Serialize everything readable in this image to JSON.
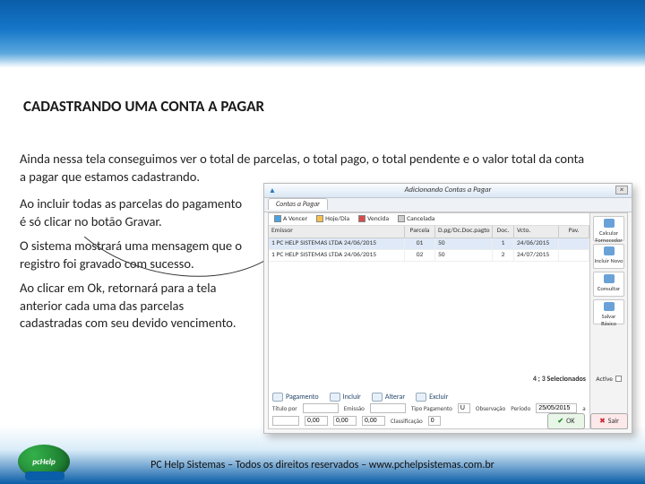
{
  "slide": {
    "title": "CADASTRANDO UMA CONTA A PAGAR",
    "intro": "Ainda nessa tela conseguimos ver o total de parcelas, o total pago, o total pendente e o valor total da conta a pagar que estamos cadastrando.",
    "para1": "Ao incluir todas as parcelas do pagamento é só clicar no botão Gravar.",
    "para2": "O sistema mostrará uma mensagem que o registro foi gravado com sucesso.",
    "para3": "Ao clicar em Ok, retornará para a tela anterior cada uma das parcelas cadastradas com seu devido vencimento.",
    "footer": "PC Help Sistemas – Todos os direitos reservados – www.pchelpsistemas.com.br",
    "logo_text": "pcHelp"
  },
  "app": {
    "window_title": "Adicionando Contas a Pagar",
    "tab": "Contas a Pagar",
    "close": "×",
    "legend": {
      "avencer": "A Vencer",
      "avencer_color": "#4aa3e0",
      "hoje": "Hoje/Dia",
      "hoje_color": "#f5c14a",
      "vencida": "Vencida",
      "vencida_color": "#d84b4b",
      "cancelada": "Cancelada",
      "cancelada_color": "#cccccc"
    },
    "headers": {
      "fornecedor": "Emissor",
      "parcela": "Parcela",
      "docpag": "D.pg/Dc.Doc.pagto",
      "doc": "Doc.",
      "vcto": "Vcto.",
      "pav": "Pav."
    },
    "rows": [
      {
        "fornecedor": "1 PC HELP SISTEMAS LTDA 24/06/2015",
        "parcela": "01",
        "docpag": "50",
        "doc": "1",
        "vcto": "24/06/2015",
        "pav": ""
      },
      {
        "fornecedor": "1 PC HELP SISTEMAS LTDA 24/06/2015",
        "parcela": "02",
        "docpag": "50",
        "doc": "2",
        "vcto": "24/07/2015",
        "pav": ""
      }
    ],
    "sidebar": {
      "calcular": "Calcular Fornecedor",
      "incluir": "Incluir Novo",
      "consultar": "Consultar",
      "salvar": "Salvar Básico"
    },
    "summary": "4 ; 3 Selecionados",
    "active_label": "Active",
    "toolbtns": {
      "pagamento": "Pagamento",
      "incluir": "Incluir",
      "alterar": "Alterar",
      "excluir": "Excluir"
    },
    "form": {
      "titulo_lbl": "Título por",
      "titulo_val": "",
      "emissao_lbl": "Emissão",
      "emissao_val": "",
      "periodo_lbl": "Período",
      "periodo_de": "25/05/2015",
      "a": "a",
      "periodo_ate": "",
      "vlr0": "0,00",
      "vlr1": "0,00",
      "vlr2": "0,00",
      "tipopag_lbl": "Tipo Pagamento",
      "tipopag_val": "U",
      "obs_lbl": "Observação",
      "num_lbl": "0",
      "class_lbl": "Classificação",
      "class_val": "0"
    },
    "buttons": {
      "ok": "OK",
      "cancel": "Sair"
    }
  }
}
